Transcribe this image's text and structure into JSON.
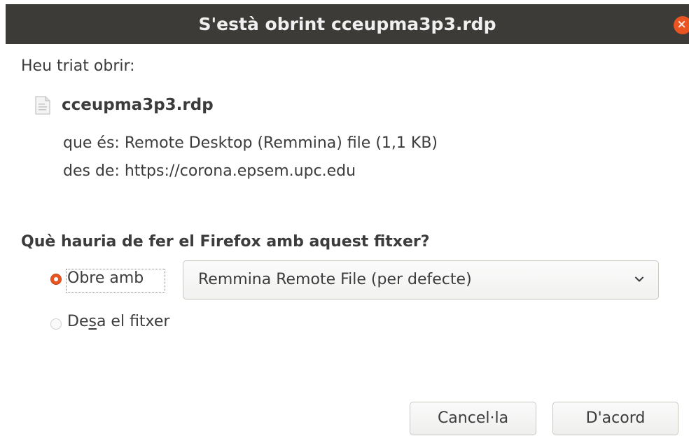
{
  "window": {
    "title": "S'està obrint cceupma3p3.rdp",
    "close_icon": "×"
  },
  "intro": "Heu triat obrir:",
  "file": {
    "icon": "document-icon",
    "name": "cceupma3p3.rdp",
    "type_line": "que és: Remote Desktop (Remmina) file (1,1 KB)",
    "source_line": "des de: https://corona.epsem.upc.edu"
  },
  "question": "Què hauria de fer el Firefox amb aquest fitxer?",
  "options": {
    "open_with": {
      "label": "Obre amb",
      "selected": true
    },
    "app_select": {
      "value": "Remmina Remote File (per defecte)",
      "arrow_icon": "chevron-down-icon"
    },
    "save_file": {
      "label_prefix": "De",
      "label_mnemonic": "s",
      "label_suffix": "a el fitxer",
      "selected": false
    }
  },
  "buttons": {
    "cancel": "Cancel·la",
    "ok": "D'acord"
  },
  "colors": {
    "titlebar": "#3c3b37",
    "accent": "#e95420",
    "text": "#3c3c3c"
  }
}
